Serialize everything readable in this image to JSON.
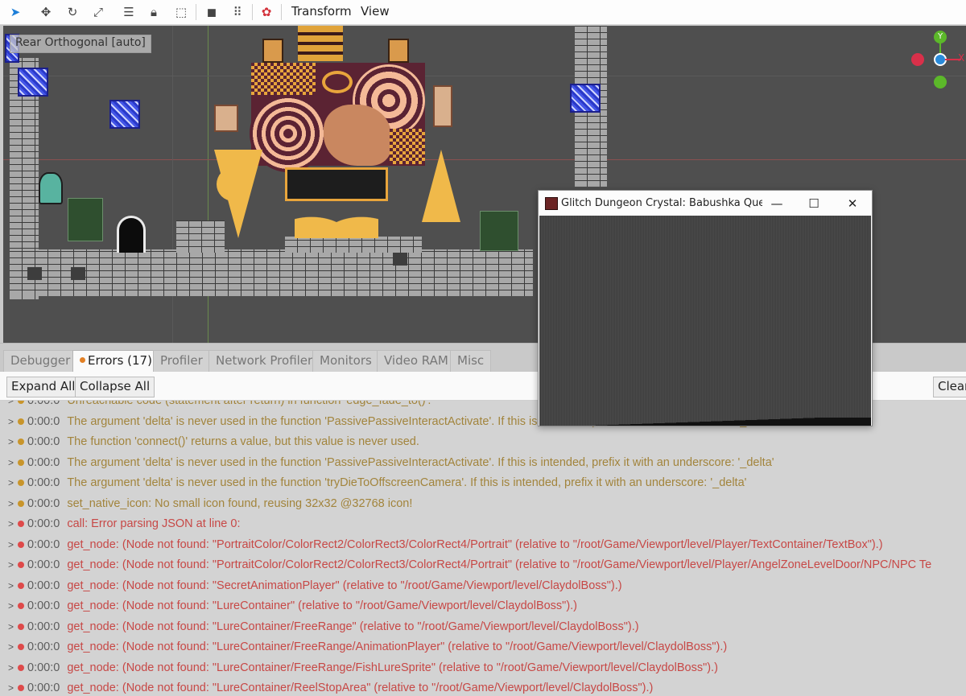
{
  "toolbar": {
    "menus": [
      "Transform",
      "View"
    ],
    "icons": [
      "select-arrow-icon",
      "move-icon",
      "rotate-icon",
      "scale-icon",
      "list-select-icon",
      "lock-icon",
      "group-icon",
      "cube-icon",
      "bones-icon",
      "dot-icon",
      "camera-override-icon"
    ],
    "active_color": "#1e7fd8"
  },
  "viewport": {
    "label": "Rear Orthogonal [auto]",
    "gizmo": {
      "axis_y": "Y",
      "axis_x": "X",
      "colors": {
        "y": "#5cb82a",
        "x": "#d9304a",
        "z": "#2a8ad9"
      }
    }
  },
  "tabs": [
    "Debugger",
    "Errors (17)",
    "Profiler",
    "Network Profiler",
    "Monitors",
    "Video RAM",
    "Misc"
  ],
  "actions": {
    "expand": "Expand All",
    "collapse": "Collapse All",
    "clear": "Clear"
  },
  "errors": [
    {
      "type": "warn",
      "time": "0:00:0",
      "msg": "Unreachable code (statement after return) in function 'edge_fade_to()'."
    },
    {
      "type": "warn",
      "time": "0:00:0",
      "msg": "The argument 'delta' is never used in the function 'PassivePassiveInteractActivate'. If this is intended, prefix it with an underscore: '_delta'"
    },
    {
      "type": "warn",
      "time": "0:00:0",
      "msg": "The function 'connect()' returns a value, but this value is never used."
    },
    {
      "type": "warn",
      "time": "0:00:0",
      "msg": "The argument 'delta' is never used in the function 'PassivePassiveInteractActivate'. If this is intended, prefix it with an underscore: '_delta'"
    },
    {
      "type": "warn",
      "time": "0:00:0",
      "msg": "The argument 'delta' is never used in the function 'tryDieToOffscreenCamera'. If this is intended, prefix it with an underscore: '_delta'"
    },
    {
      "type": "warn",
      "time": "0:00:0",
      "msg": "set_native_icon: No small icon found, reusing 32x32 @32768 icon!"
    },
    {
      "type": "err",
      "time": "0:00:0",
      "msg": "call: Error parsing JSON at line 0:"
    },
    {
      "type": "err",
      "time": "0:00:0",
      "msg": "get_node: (Node not found: \"PortraitColor/ColorRect2/ColorRect3/ColorRect4/Portrait\" (relative to \"/root/Game/Viewport/level/Player/TextContainer/TextBox\").)"
    },
    {
      "type": "err",
      "time": "0:00:0",
      "msg": "get_node: (Node not found: \"PortraitColor/ColorRect2/ColorRect3/ColorRect4/Portrait\" (relative to \"/root/Game/Viewport/level/Player/AngelZoneLevelDoor/NPC/NPC Te"
    },
    {
      "type": "err",
      "time": "0:00:0",
      "msg": "get_node: (Node not found: \"SecretAnimationPlayer\" (relative to \"/root/Game/Viewport/level/ClaydolBoss\").)"
    },
    {
      "type": "err",
      "time": "0:00:0",
      "msg": "get_node: (Node not found: \"LureContainer\" (relative to \"/root/Game/Viewport/level/ClaydolBoss\").)"
    },
    {
      "type": "err",
      "time": "0:00:0",
      "msg": "get_node: (Node not found: \"LureContainer/FreeRange\" (relative to \"/root/Game/Viewport/level/ClaydolBoss\").)"
    },
    {
      "type": "err",
      "time": "0:00:0",
      "msg": "get_node: (Node not found: \"LureContainer/FreeRange/AnimationPlayer\" (relative to \"/root/Game/Viewport/level/ClaydolBoss\").)"
    },
    {
      "type": "err",
      "time": "0:00:0",
      "msg": "get_node: (Node not found: \"LureContainer/FreeRange/FishLureSprite\" (relative to \"/root/Game/Viewport/level/ClaydolBoss\").)"
    },
    {
      "type": "err",
      "time": "0:00:0",
      "msg": "get_node: (Node not found: \"LureContainer/ReelStopArea\" (relative to \"/root/Game/Viewport/level/ClaydolBoss\").)"
    }
  ],
  "game_window": {
    "title": "Glitch Dungeon Crystal: Babushka Quest (DE...",
    "minimize": "—",
    "maximize": "☐",
    "close": "✕"
  }
}
